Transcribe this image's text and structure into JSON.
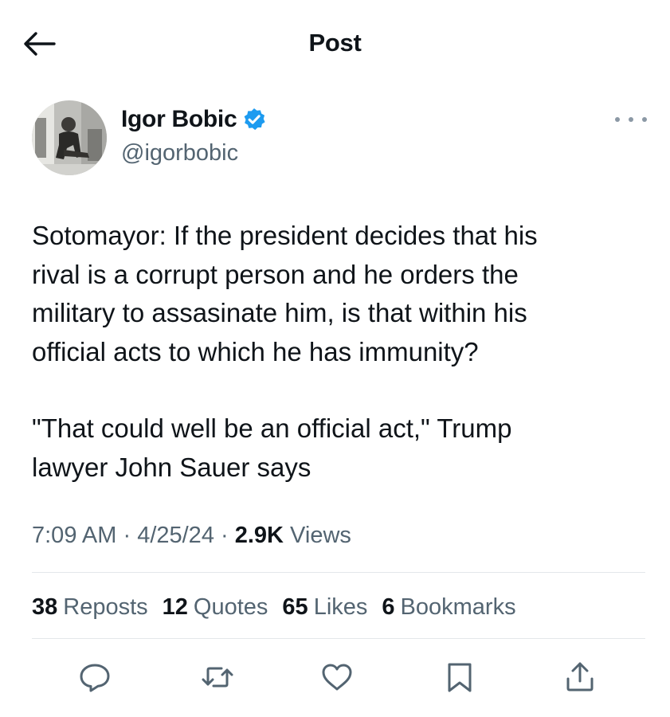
{
  "header": {
    "title": "Post",
    "back_icon": "arrow-left-icon"
  },
  "author": {
    "name": "Igor Bobic",
    "handle": "@igorbobic",
    "verified_icon": "verified-badge-icon",
    "verified_color": "#1d9bf0",
    "more_icon": "more-horizontal-icon"
  },
  "tweet": {
    "paragraphs": [
      "Sotomayor: If the president decides that his\nrival is a corrupt person and he orders the\nmilitary to assasinate him, is that within his\nofficial acts to which he has immunity?",
      "\"That could well be an official act,\" Trump\nlawyer John Sauer says"
    ]
  },
  "meta": {
    "time": "7:09 AM",
    "sep1": " · ",
    "date": "4/25/24",
    "sep2": " · ",
    "views_count": "2.9K",
    "views_label": " Views"
  },
  "stats": [
    {
      "count": "38",
      "label": "Reposts"
    },
    {
      "count": "12",
      "label": "Quotes"
    },
    {
      "count": "65",
      "label": "Likes"
    },
    {
      "count": "6",
      "label": "Bookmarks"
    }
  ],
  "actions": [
    {
      "name": "reply-icon"
    },
    {
      "name": "repost-icon"
    },
    {
      "name": "like-icon"
    },
    {
      "name": "bookmark-icon"
    },
    {
      "name": "share-icon"
    }
  ],
  "colors": {
    "text": "#0f1419",
    "secondary": "#536471",
    "divider": "#e3e7ea"
  }
}
